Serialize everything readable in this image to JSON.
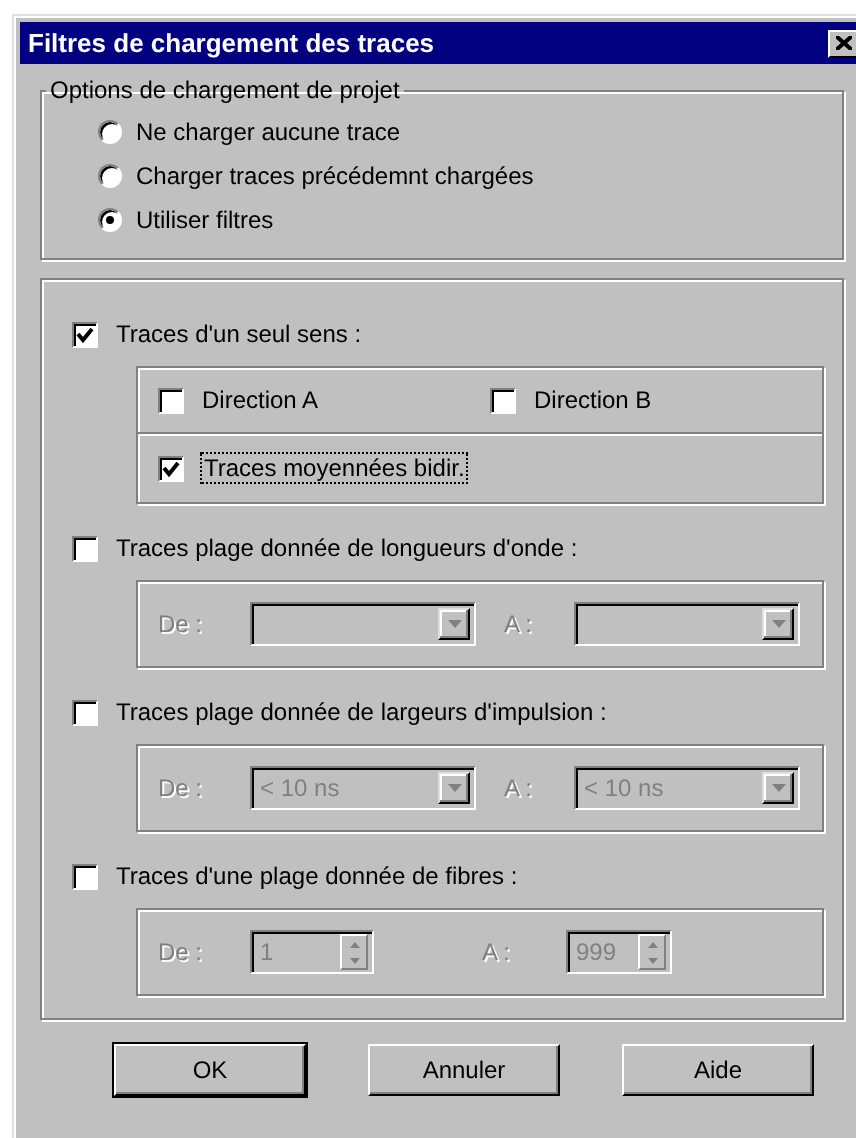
{
  "window": {
    "title": "Filtres de chargement des traces"
  },
  "project_options": {
    "legend": "Options de chargement de projet",
    "options": [
      {
        "label": "Ne charger aucune trace",
        "selected": false
      },
      {
        "label": "Charger traces précédemnt chargées",
        "selected": false
      },
      {
        "label": "Utiliser filtres",
        "selected": true
      }
    ]
  },
  "filters": [
    {
      "kind": "direction",
      "label": "Traces d'un seul sens :",
      "checked": true,
      "rows": [
        {
          "options": [
            {
              "label": "Direction A",
              "checked": false,
              "focused": false
            },
            {
              "label": "Direction B",
              "checked": false,
              "focused": false
            }
          ]
        },
        {
          "options": [
            {
              "label": "Traces moyennées bidir.",
              "checked": true,
              "focused": true
            }
          ]
        }
      ]
    },
    {
      "kind": "combo_range",
      "label": "Traces plage donnée de longueurs d'onde :",
      "checked": false,
      "disabled": true,
      "from_label": "De :",
      "to_label": "A :"
    },
    {
      "kind": "combo_range",
      "label": "Traces plage donnée de largeurs d'impulsion :",
      "checked": false,
      "disabled": true,
      "from_label": "De :",
      "from_value": "< 10 ns",
      "to_label": "A :",
      "to_value": "< 10 ns"
    },
    {
      "kind": "spin_range",
      "label": "Traces d'une plage donnée de fibres :",
      "checked": false,
      "disabled": true,
      "from_label": "De :",
      "from_value": "1",
      "to_label": "A :",
      "to_value": "999"
    }
  ],
  "buttons": [
    {
      "label": "OK",
      "default": true
    },
    {
      "label": "Annuler",
      "default": false
    },
    {
      "label": "Aide",
      "default": false
    }
  ]
}
